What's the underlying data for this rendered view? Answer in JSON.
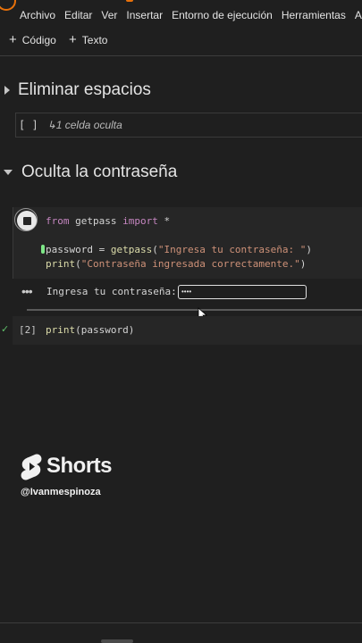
{
  "menu": {
    "items": [
      "Archivo",
      "Editar",
      "Ver",
      "Insertar",
      "Entorno de ejecución",
      "Herramientas",
      "A"
    ]
  },
  "toolbar": {
    "code_label": "Código",
    "text_label": "Texto"
  },
  "sections": [
    {
      "title": "Eliminar espacios",
      "collapsed": true,
      "hidden_summary": "1 celda oculta",
      "hidden_bracket": "[ ]"
    },
    {
      "title": "Oculta la contraseña",
      "collapsed": false
    }
  ],
  "code_cell_1": {
    "lines": [
      "from getpass import *",
      "",
      "password = getpass(\"Ingresa tu contraseña: \")",
      "print(\"Contraseña ingresada correctamente.\")"
    ],
    "running": true
  },
  "input_prompt": {
    "label": "Ingresa tu contraseña:",
    "masked_value": "••••"
  },
  "code_cell_2": {
    "exec_count": "[2]",
    "code": "print(password)",
    "status": "check"
  },
  "overlay": {
    "brand": "Shorts",
    "handle": "@Ivanmespinoza"
  },
  "colors": {
    "background": "#1f1f1f",
    "cell_bg": "#262626",
    "keyword": "#c586c0",
    "function": "#dcdcaa",
    "string": "#ce9178",
    "success": "#5fbf6a"
  }
}
